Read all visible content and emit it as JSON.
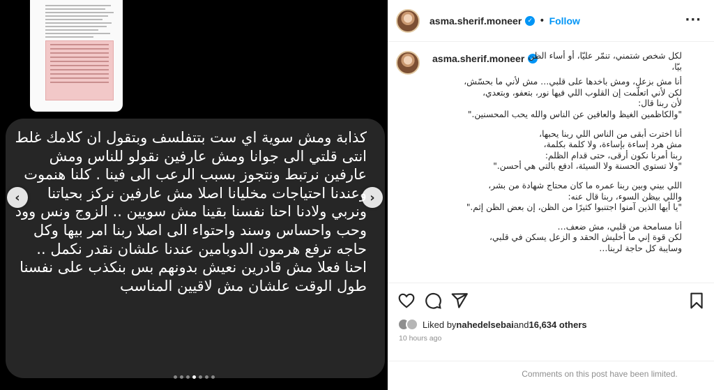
{
  "media": {
    "bubble_text": "كذابة ومش سوية اي ست بتتفلسف وبتقول ان كلامك غلط انتى قلتي الى جوانا ومش عارفين نقولو للناس ومش عارفين نرتبط ونتجوز بسبب الرعب الى فينا . كلنا هنموت وعندنا احتياجات مخليانا اصلا مش عارفين نركز بحياتنا ونربي ولادنا احنا نفسنا بقينا مش سويين .. الزوج ونس وود وحب واحساس وسند واحتواء الى اصلا ربنا امر بيها وكل حاجه ترفع هرمون الدوبامين عندنا علشان نقدر نكمل .. احنا فعلا مش قادرين نعيش بدونهم بس بنكذب على نفسنا طول الوقت علشان مش لاقيين المناسب",
    "prev_icon": "chevron-left-icon",
    "next_icon": "chevron-right-icon"
  },
  "header": {
    "username": "asma.sherif.moneer",
    "separator": "•",
    "follow_label": "Follow"
  },
  "caption": {
    "username": "asma.sherif.moneer",
    "lines": [
      "لكل شخص شتمني، تنمّر عليّا، أو أساء الظن",
      "بيّا،",
      "أنا مش بزعل، ومش باخدها على قلبي… مش لأني ما بحسّش،",
      "لكن لأني اتعلّمت إن القلوب اللي فيها نور، بتعفو، وبتعدي،",
      "لأن ربنا قال:",
      "\"والكاظمين الغيظ والعافين عن الناس والله يحب المحسنين.\"",
      "",
      "أنا اخترت أبقى من الناس اللي ربنا يحبها،",
      "مش هرد إساءة بإساءة، ولا كلمة بكلمة،",
      "ربنا أمرنا نكون أرقى، حتى قدام الظلم:",
      "\"ولا تستوي الحسنة ولا السيئة، ادفع بالتي هي أحسن.\"",
      "",
      "اللي بيني وبين ربنا عمره ما كان محتاج شهادة من بشر،",
      "واللي بيظن السوء، ربنا قال عنه:",
      "\"يا أيها الذين آمنوا اجتنبوا كثيرًا من الظن، إن بعض الظن إثم.\"",
      "",
      "أنا مسامحة من قلبي، مش ضعف…",
      "لكن قوة إني ما أخليش الحقد و الزعل يسكن في قلبي،",
      "وسايبة كل حاجة لربنا…"
    ]
  },
  "likes": {
    "prefix": "Liked by ",
    "user": "nahedelsebai",
    "middle": " and ",
    "count": "16,634 others"
  },
  "timestamp": "10 hours ago",
  "comments_notice": "Comments on this post have been limited.",
  "colors": {
    "accent": "#0095f6",
    "bubble": "#262626",
    "media_bg": "#000000"
  }
}
